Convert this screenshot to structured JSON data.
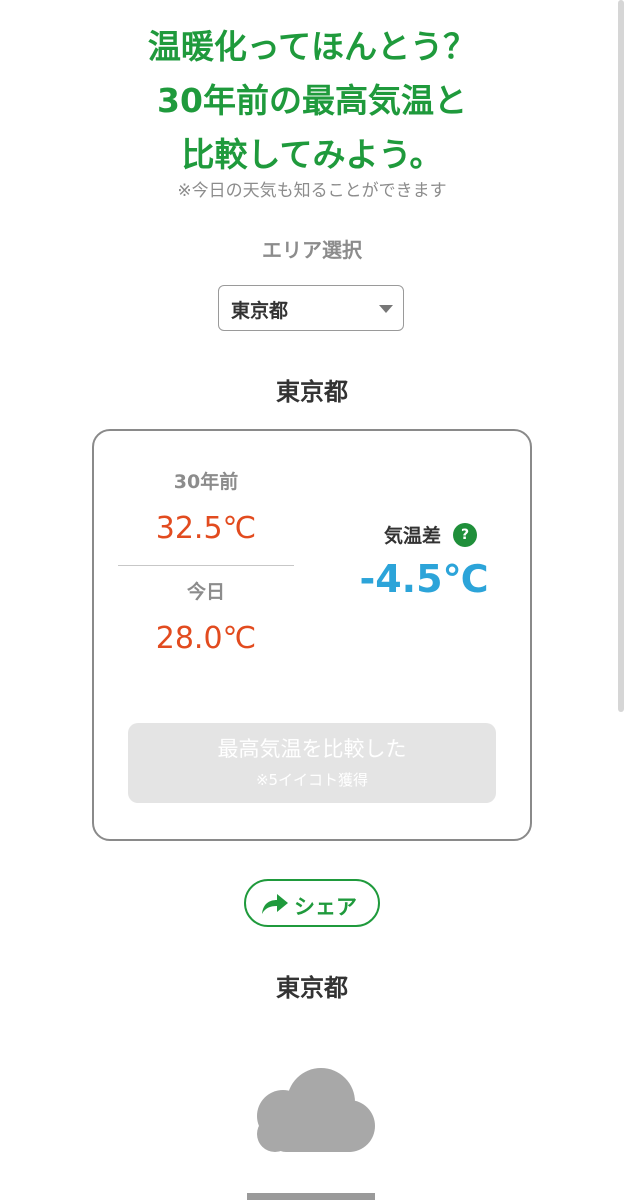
{
  "headline": {
    "line1": "温暖化ってほんとう？",
    "line2": "30年前の最高気温と",
    "line3": "比較してみよう。"
  },
  "note": "※今日の天気も知ることができます",
  "area_select": {
    "label": "エリア選択",
    "selected": "東京都"
  },
  "comparison": {
    "area_name": "東京都",
    "past_label": "30年前",
    "past_temp": "32.5℃",
    "today_label": "今日",
    "today_temp": "28.0℃",
    "diff_label": "気温差",
    "diff_help": "?",
    "diff_value": "-4.5℃",
    "compare_button": {
      "label": "最高気温を比較した",
      "sub": "※5イイコト獲得"
    }
  },
  "share": {
    "label": "シェア",
    "icon": "share-arrow-icon"
  },
  "weather": {
    "area_name": "東京都",
    "icon": "cloud-icon"
  },
  "colors": {
    "accent_green": "#1f9a3c",
    "temp_red": "#e24b1f",
    "diff_blue": "#2ca4d9"
  }
}
